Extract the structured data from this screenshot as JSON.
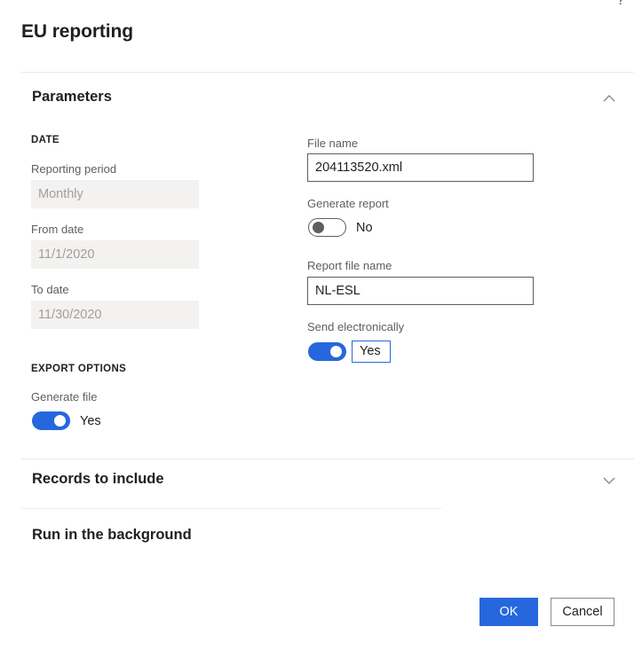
{
  "header": {
    "title": "EU reporting",
    "help_icon": "question-mark-icon"
  },
  "sections": {
    "parameters": {
      "title": "Parameters",
      "expanded": true,
      "chevron": "chevron-up-icon"
    },
    "records_to_include": {
      "title": "Records to include",
      "expanded": false,
      "chevron": "chevron-down-icon"
    },
    "run_in_background": {
      "title": "Run in the background"
    }
  },
  "left_column": {
    "date_group_label": "DATE",
    "fields": [
      {
        "label": "Reporting period",
        "value": "Monthly",
        "disabled": true
      },
      {
        "label": "From date",
        "value": "11/1/2020",
        "disabled": true
      },
      {
        "label": "To date",
        "value": "11/30/2020",
        "disabled": true
      }
    ],
    "export_group_label": "EXPORT OPTIONS",
    "generate_file": {
      "label": "Generate file",
      "state": "Yes",
      "on": true
    }
  },
  "right_column": {
    "file_name": {
      "label": "File name",
      "value": "204113520.xml"
    },
    "generate_report": {
      "label": "Generate report",
      "state": "No",
      "on": false
    },
    "report_file_name": {
      "label": "Report file name",
      "value": "NL-ESL"
    },
    "send_electronically": {
      "label": "Send electronically",
      "state": "Yes",
      "on": true,
      "focused": true
    }
  },
  "footer": {
    "ok_label": "OK",
    "cancel_label": "Cancel"
  },
  "colors": {
    "accent_blue": "#2767dd",
    "text_primary": "#201f1e",
    "text_secondary": "#605e5c",
    "text_disabled": "#a19f9d",
    "field_disabled_bg": "#f3f2f1",
    "divider": "#edebe9"
  }
}
